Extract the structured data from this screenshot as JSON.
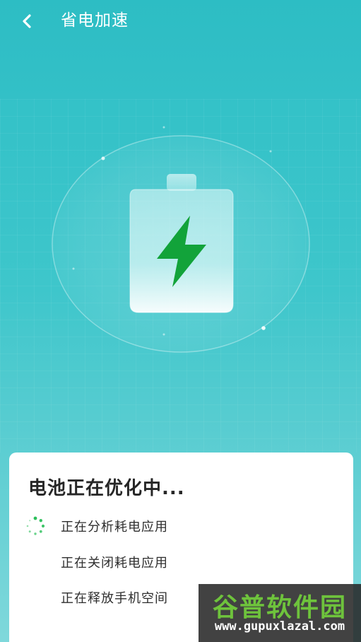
{
  "header": {
    "title": "省电加速",
    "back_icon": "chevron-left-icon"
  },
  "hero": {
    "icon": "battery-charging-icon",
    "bolt_color": "#12a33a"
  },
  "status": {
    "title": "电池正在优化中...",
    "tasks": [
      {
        "label": "正在分析耗电应用",
        "state": "in-progress",
        "icon": "loading-spinner-icon"
      },
      {
        "label": "正在关闭耗电应用",
        "state": "pending"
      },
      {
        "label": "正在释放手机空间",
        "state": "pending"
      }
    ]
  },
  "watermark": {
    "brand": "谷普软件园",
    "url": "www.gupuxlazal.com"
  },
  "colors": {
    "background": "#33c0c7",
    "card": "#ffffff",
    "spinner": "#2bbf5a"
  }
}
